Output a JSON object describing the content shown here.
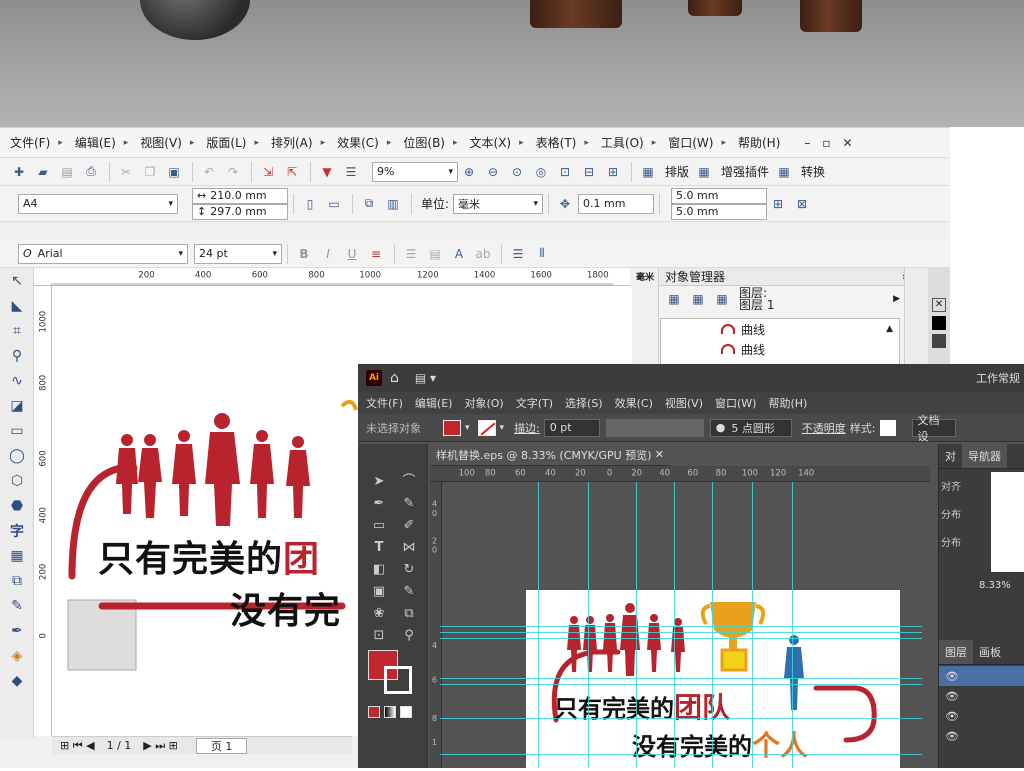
{
  "corel": {
    "menu": [
      {
        "label": "文件(F)"
      },
      {
        "label": "编辑(E)"
      },
      {
        "label": "视图(V)"
      },
      {
        "label": "版面(L)"
      },
      {
        "label": "排列(A)"
      },
      {
        "label": "效果(C)"
      },
      {
        "label": "位图(B)"
      },
      {
        "label": "文本(X)"
      },
      {
        "label": "表格(T)"
      },
      {
        "label": "工具(O)"
      },
      {
        "label": "窗口(W)"
      },
      {
        "label": "帮助(H)"
      }
    ],
    "toolbar": {
      "zoom": "9%",
      "layout_label": "排版",
      "plugin_label": "增强插件",
      "convert_label": "转换"
    },
    "props": {
      "paper": "A4",
      "width": "210.0 mm",
      "height": "297.0 mm",
      "unit_label": "单位:",
      "unit": "毫米",
      "nudge": "0.1 mm",
      "dup_x": "5.0 mm",
      "dup_y": "5.0 mm"
    },
    "text_bar": {
      "font": "Arial",
      "size": "24 pt"
    },
    "ruler": {
      "ticks": [
        "200",
        "400",
        "600",
        "800",
        "1000",
        "1200",
        "1400",
        "1600",
        "1800"
      ],
      "unit": "毫米",
      "vticks": [
        "1000",
        "800",
        "600",
        "400",
        "200",
        "0"
      ]
    },
    "object_manager": {
      "title": "对象管理器",
      "layer_line1": "图层:",
      "layer_line2": "图层 1",
      "items": [
        "曲线",
        "曲线"
      ]
    },
    "status": {
      "page_count": "1 / 1",
      "page_tab": "页 1"
    },
    "artwork": {
      "line1": "只有完美的",
      "line1_red": "团",
      "line2": "没有完"
    }
  },
  "illustrator": {
    "logo": "Ai",
    "workspace": "工作常规",
    "menu": [
      "文件(F)",
      "编辑(E)",
      "对象(O)",
      "文字(T)",
      "选择(S)",
      "效果(C)",
      "视图(V)",
      "窗口(W)",
      "帮助(H)"
    ],
    "control": {
      "no_selection": "未选择对象",
      "stroke_label": "描边:",
      "stroke_value": "0 pt",
      "brush": "5 点圆形",
      "opacity_label": "不透明度",
      "style_label": "样式:",
      "doc_setup": "文档设"
    },
    "doc_tab": "样机替换.eps @ 8.33% (CMYK/GPU 预览)",
    "ruler_ticks": [
      "100",
      "80",
      "60",
      "40",
      "20",
      "0",
      "20",
      "40",
      "60",
      "80",
      "100",
      "120",
      "140"
    ],
    "vruler_ticks": [
      "4",
      "0",
      "2",
      "0",
      "4",
      "6",
      "8",
      "1"
    ],
    "right_panel": {
      "tab1": "对",
      "navigator": "导航器",
      "align": "对齐",
      "distribute1": "分布",
      "distribute2": "分布",
      "zoom": "8.33%",
      "layers": "图层",
      "artboard": "画板"
    },
    "artwork": {
      "line1": "只有完美的",
      "line1_red": "团队",
      "line2": "没有完美的",
      "line2_orange": "个人"
    },
    "colors": {
      "fill": "#c1272d",
      "guide": "#39d8e0",
      "brand_red": "#b8232d",
      "trophy": "#e8a21a",
      "blue_figure": "#2f6fb0"
    }
  }
}
